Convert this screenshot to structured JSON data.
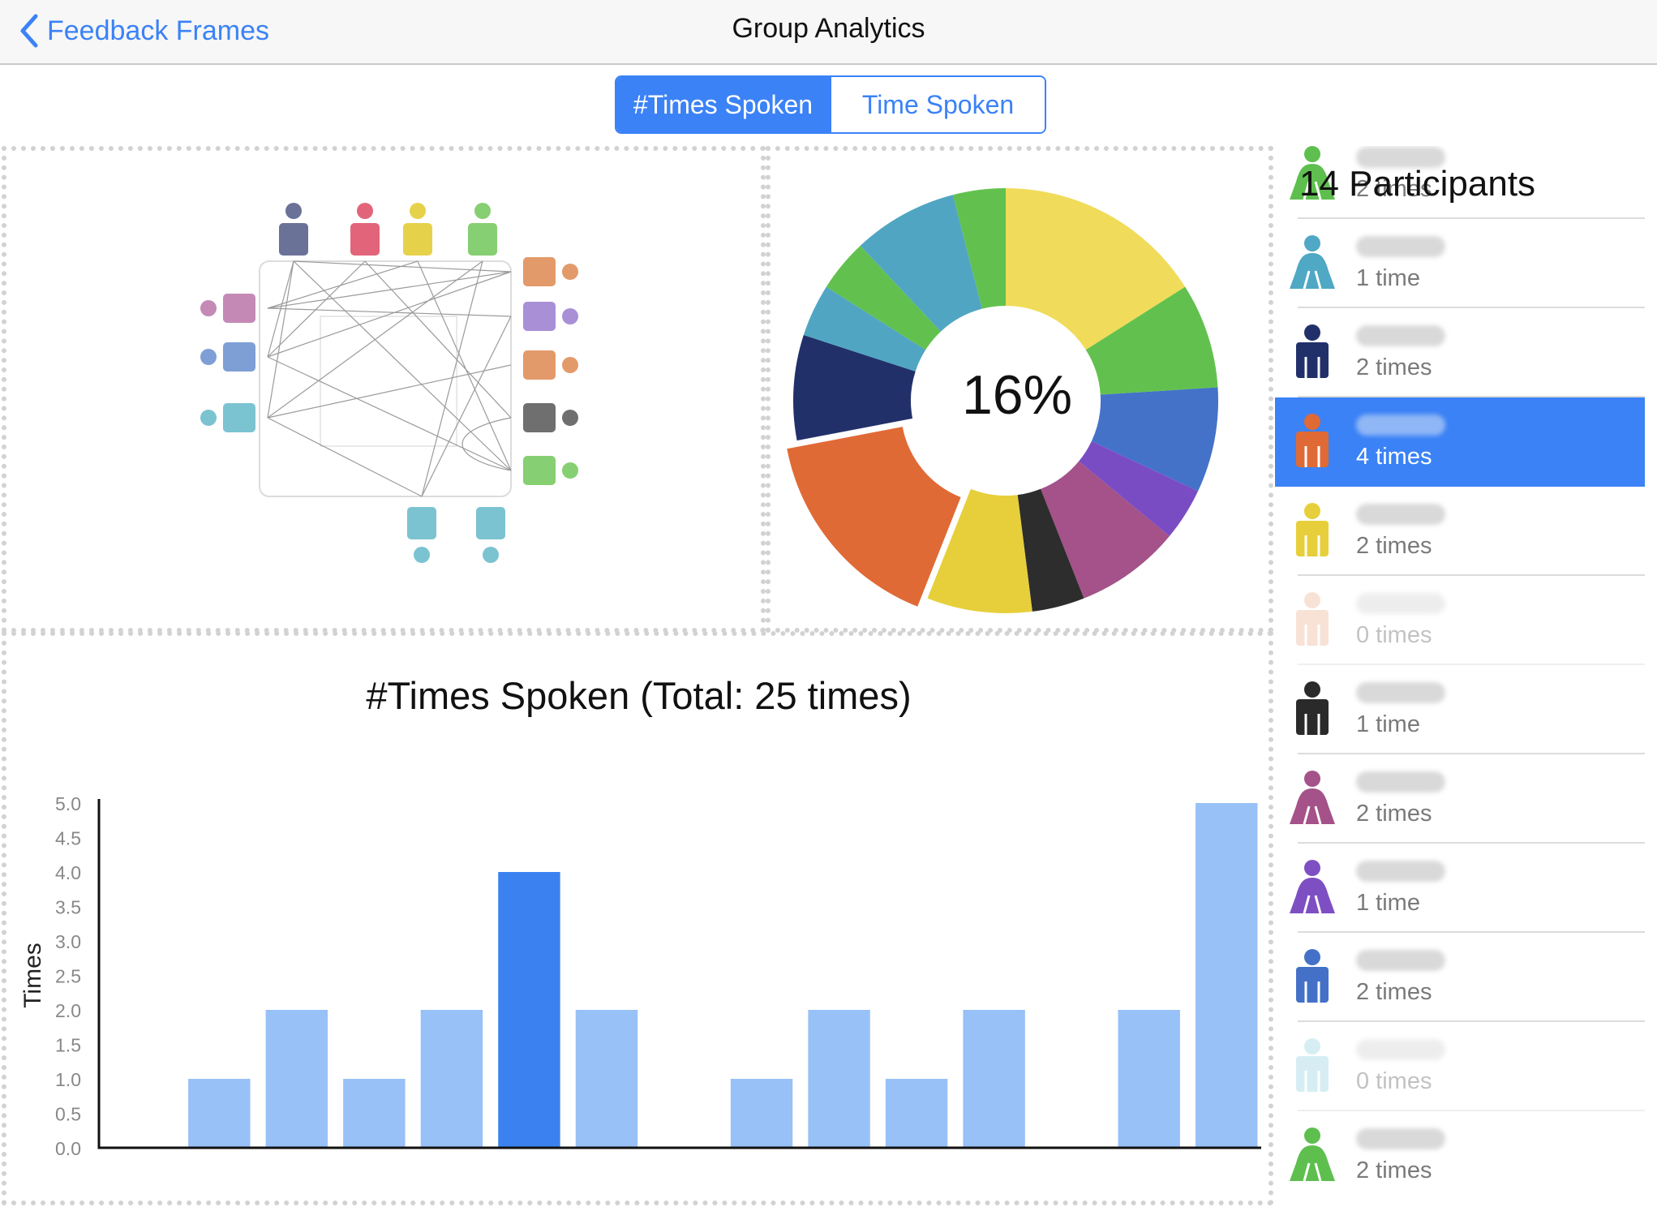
{
  "nav": {
    "back_label": "Feedback Frames",
    "title": "Group Analytics"
  },
  "segments": [
    {
      "label": "#Times Spoken",
      "active": true
    },
    {
      "label": "Time Spoken",
      "active": false
    }
  ],
  "donut": {
    "center_label": "16%"
  },
  "participants_title": "14 Participants",
  "participants": [
    {
      "count": "2 times",
      "color": "#5ebf4f",
      "shape": "dress"
    },
    {
      "count": "1 time",
      "color": "#4fa8c4",
      "shape": "dress"
    },
    {
      "count": "2 times",
      "color": "#22306a",
      "shape": "suit"
    },
    {
      "count": "4 times",
      "color": "#e06a35",
      "shape": "suit",
      "selected": true
    },
    {
      "count": "2 times",
      "color": "#e6cf3a",
      "shape": "suit"
    },
    {
      "count": "0 times",
      "color": "#f0bfa6",
      "shape": "suit",
      "faded": true
    },
    {
      "count": "1 time",
      "color": "#2a2a2a",
      "shape": "suit"
    },
    {
      "count": "2 times",
      "color": "#a45289",
      "shape": "dress"
    },
    {
      "count": "1 time",
      "color": "#7e4fc2",
      "shape": "dress"
    },
    {
      "count": "2 times",
      "color": "#4471c7",
      "shape": "suit"
    },
    {
      "count": "0 times",
      "color": "#a5dbe6",
      "shape": "suit",
      "faded": true
    },
    {
      "count": "2 times",
      "color": "#5ebf4f",
      "shape": "dress"
    }
  ],
  "chart_data": [
    {
      "type": "pie",
      "donut": true,
      "center_label": "16%",
      "values": [
        4,
        2,
        2,
        1,
        2,
        1,
        2,
        4,
        2,
        1,
        1,
        2,
        1
      ],
      "colors": [
        "#f0dc5a",
        "#62c14e",
        "#4472c8",
        "#7a4cc4",
        "#a45289",
        "#2d2d2d",
        "#e6cf3a",
        "#e06a35",
        "#22306a",
        "#50a6c2",
        "#62c14e",
        "#50a6c2",
        "#62c14e"
      ],
      "highlight_index": 7
    },
    {
      "type": "bar",
      "title": "#Times Spoken (Total: 25 times)",
      "ylabel": "Times",
      "ylim": [
        0,
        5
      ],
      "yticks": [
        "0.0",
        "0.5",
        "1.0",
        "1.5",
        "2.0",
        "2.5",
        "3.0",
        "3.5",
        "4.0",
        "4.5",
        "5.0"
      ],
      "values": [
        0,
        1,
        2,
        1,
        2,
        4,
        2,
        0,
        1,
        2,
        1,
        2,
        0,
        2,
        5
      ],
      "highlight_index": 5,
      "colors": {
        "bar": "#97c1f7",
        "highlight": "#3b82f0"
      }
    }
  ]
}
